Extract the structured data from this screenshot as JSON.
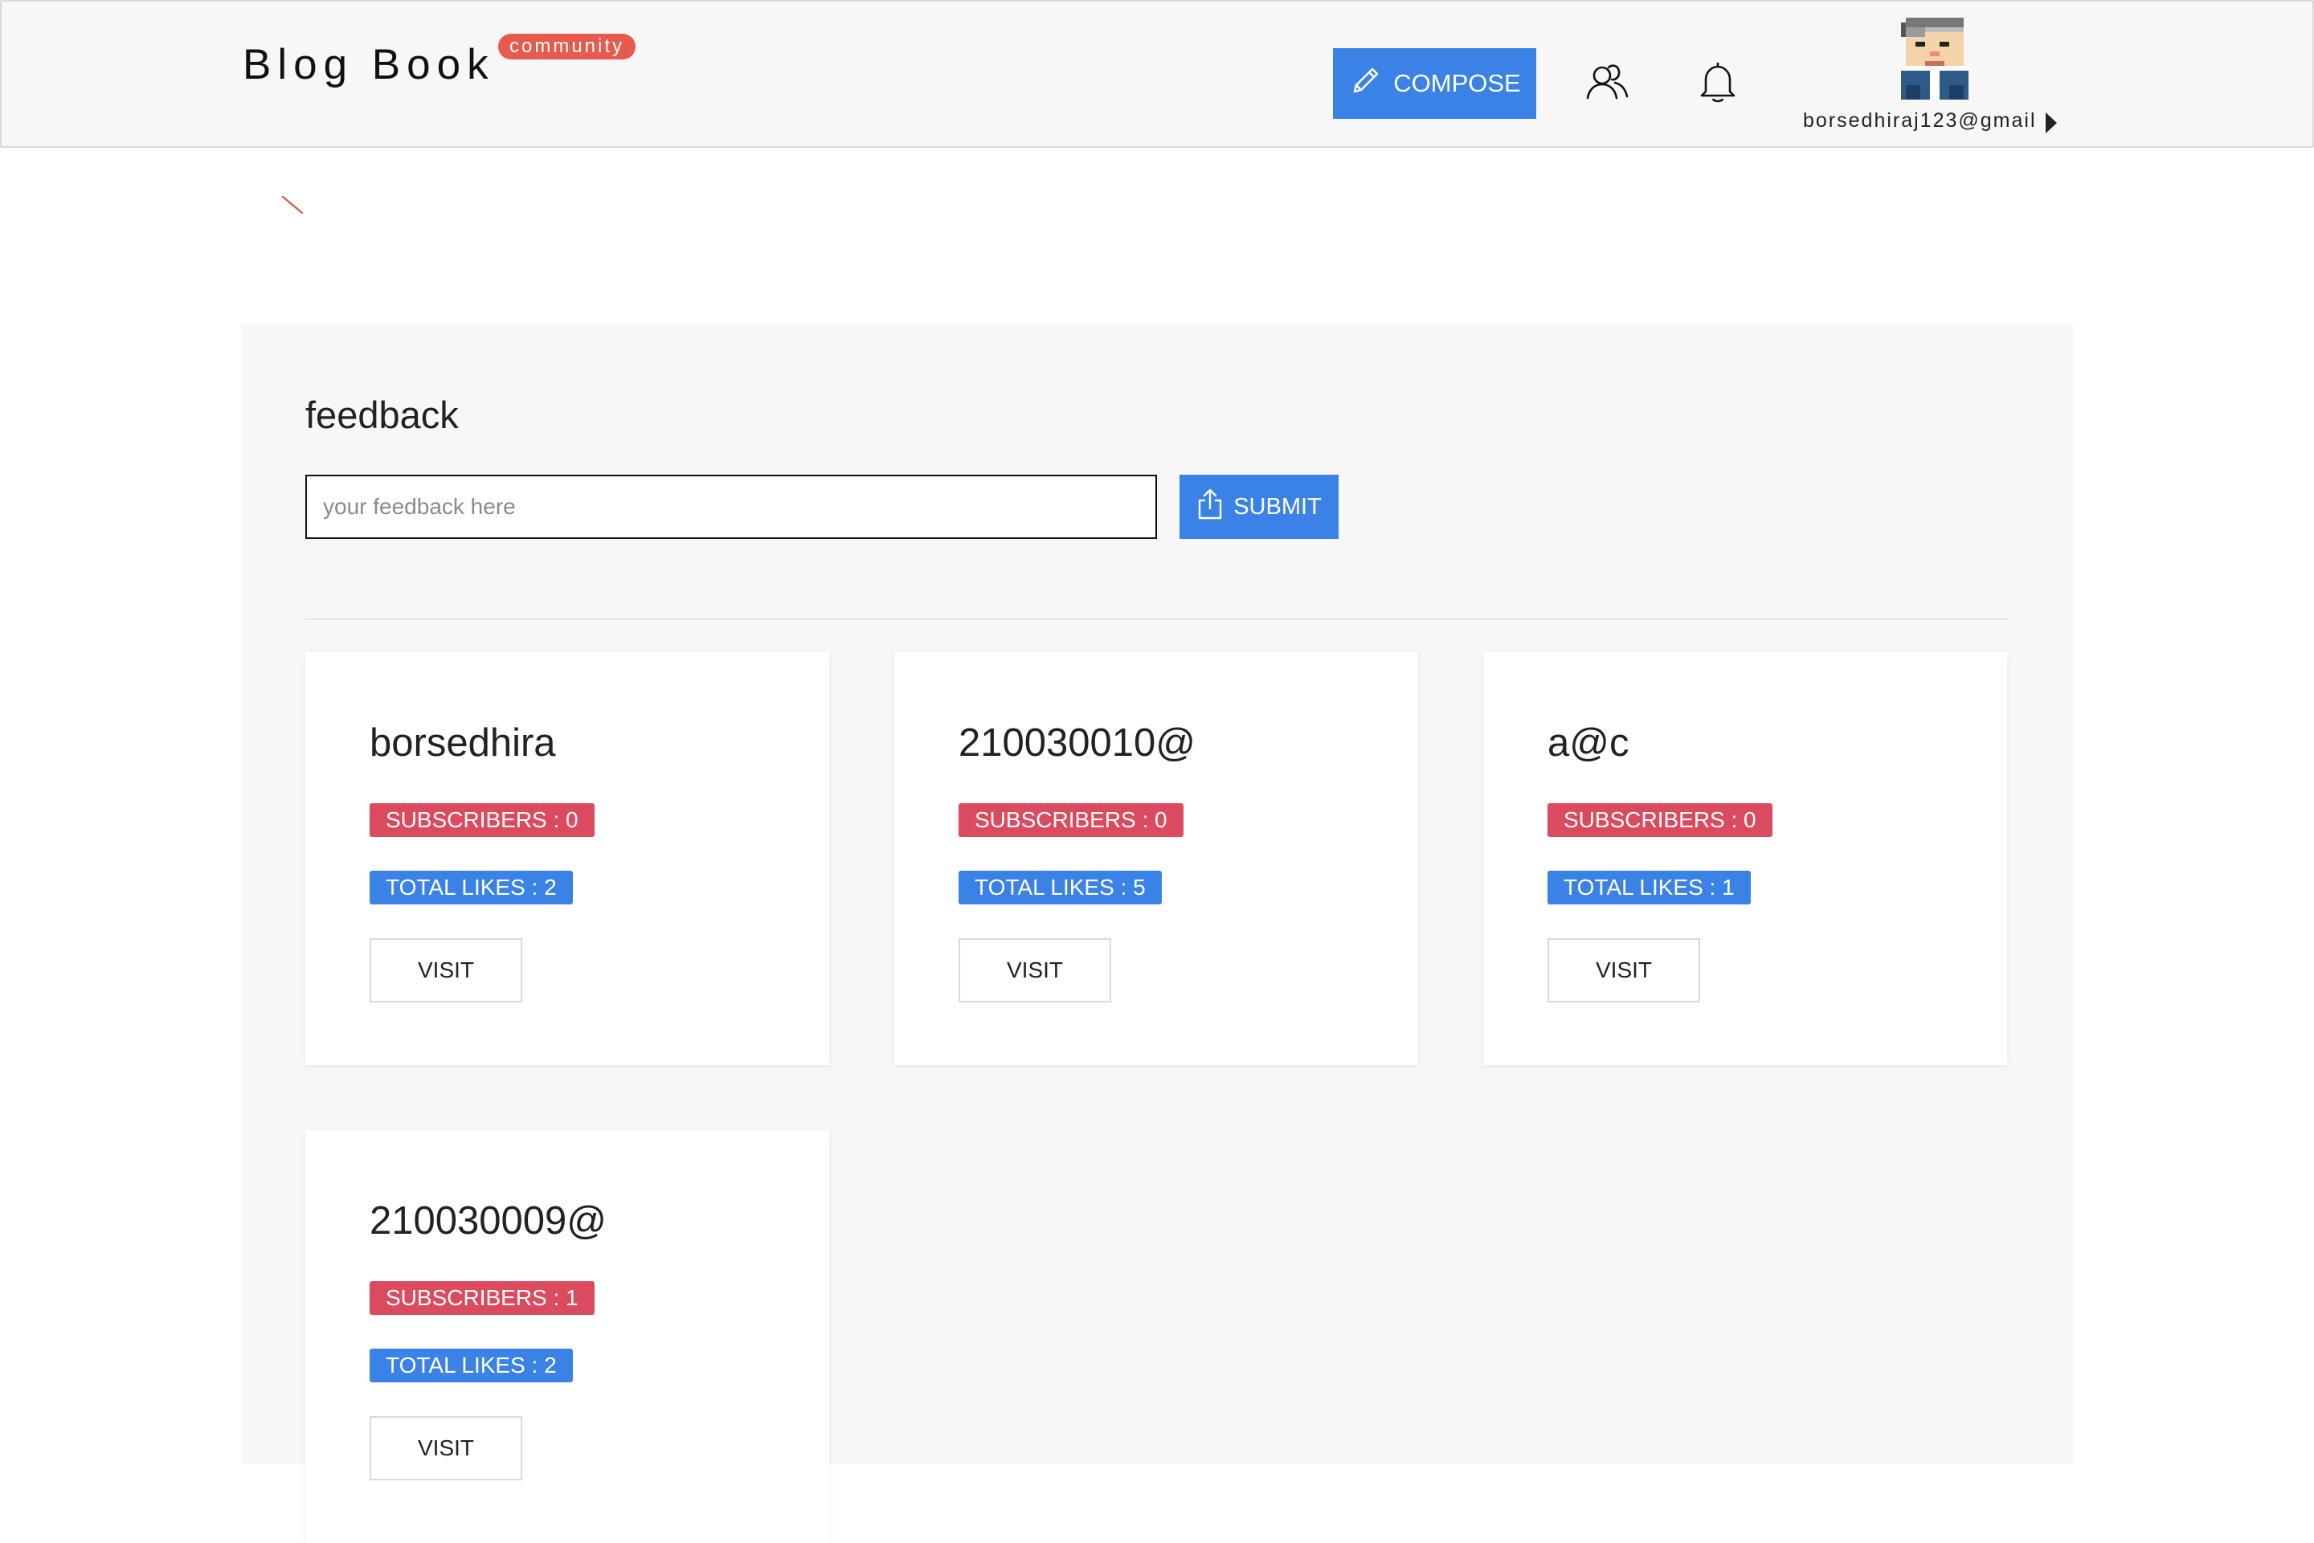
{
  "header": {
    "brand": "Blog Book",
    "community_badge": "community",
    "compose_label": "COMPOSE",
    "user_email": "borsedhiraj123@gmail"
  },
  "feedback": {
    "title": "feedback",
    "placeholder": "your feedback here",
    "value": "",
    "submit_label": "SUBMIT"
  },
  "cards": [
    {
      "name": "borsedhira",
      "subscribers": "SUBSCRIBERS : 0",
      "likes": "TOTAL LIKES : 2",
      "visit_label": "VISIT"
    },
    {
      "name": "210030010@",
      "subscribers": "SUBSCRIBERS : 0",
      "likes": "TOTAL LIKES : 5",
      "visit_label": "VISIT"
    },
    {
      "name": "a@c",
      "subscribers": "SUBSCRIBERS : 0",
      "likes": "TOTAL LIKES : 1",
      "visit_label": "VISIT"
    },
    {
      "name": "210030009@",
      "subscribers": "SUBSCRIBERS : 1",
      "likes": "TOTAL LIKES : 2",
      "visit_label": "VISIT"
    }
  ],
  "icons": {
    "compose": "pencil-icon",
    "people": "users-icon",
    "notifications": "bell-icon",
    "submit": "share-upload-icon",
    "user_menu": "caret-right-icon"
  },
  "colors": {
    "primary": "#3b82e6",
    "subscribers_badge": "#db4a5f",
    "community_badge": "#e75a4e",
    "panel_background": "#f7f7f7"
  }
}
